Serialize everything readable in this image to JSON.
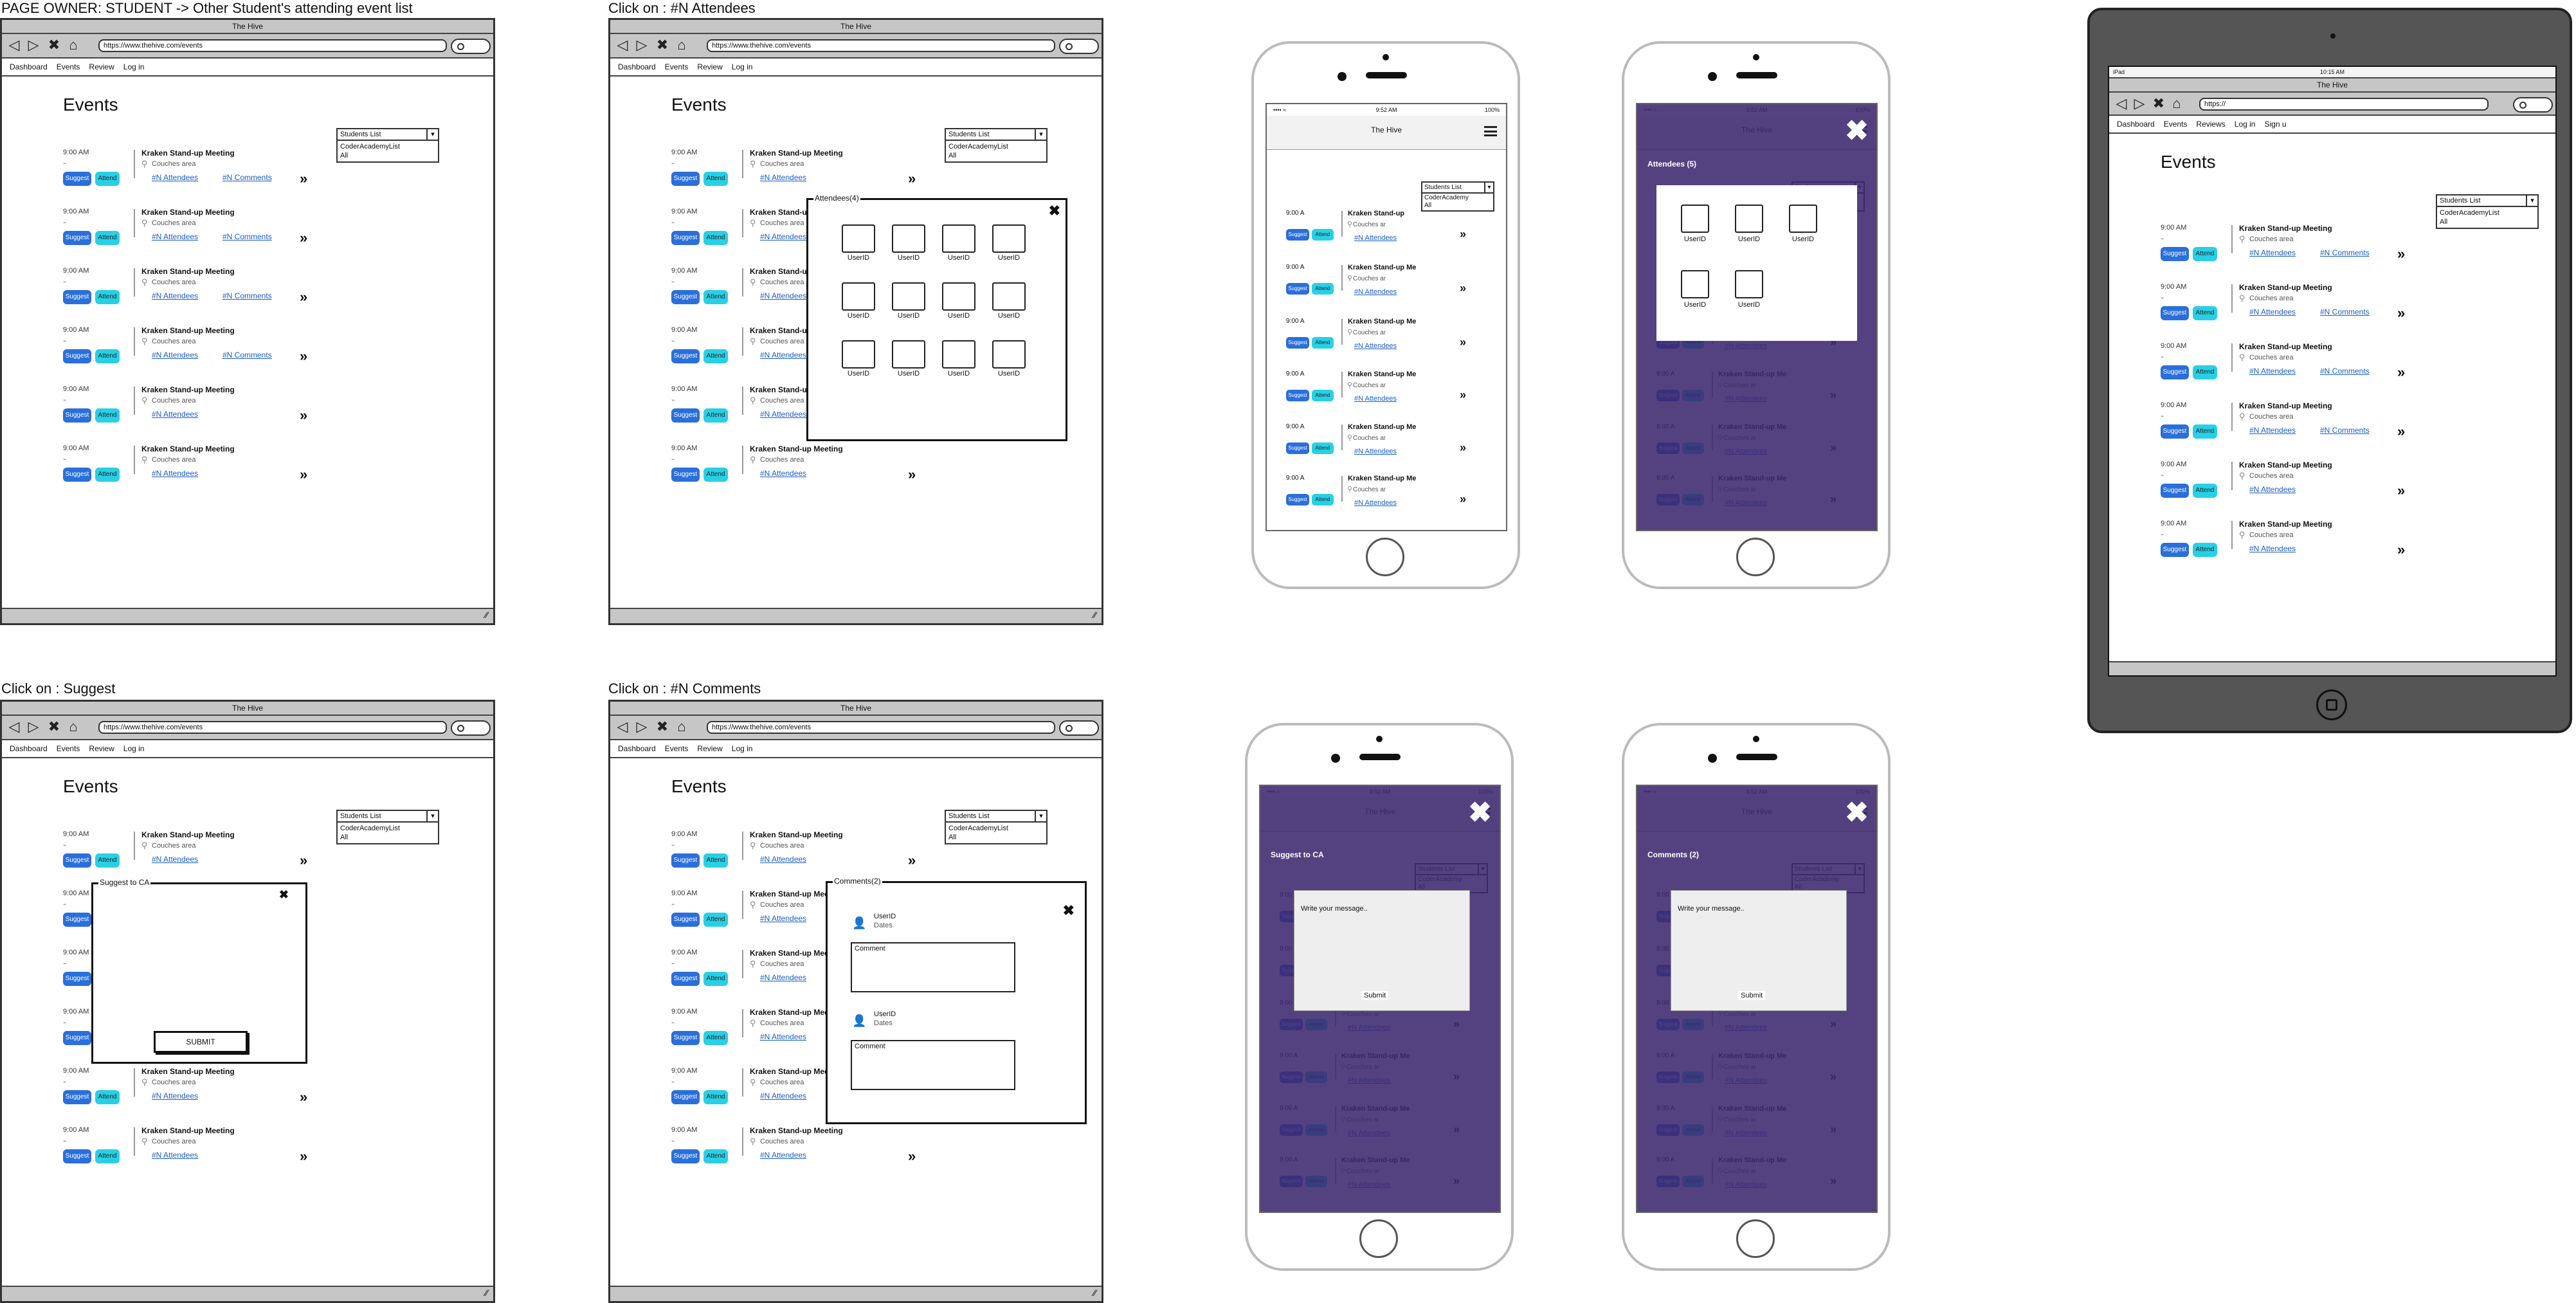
{
  "captions": {
    "c1": "PAGE OWNER: STUDENT -> Other Student's attending event list",
    "c2": "Click on : #N Attendees",
    "c3": "Click on : Suggest",
    "c4": "Click on : #N Comments"
  },
  "browser": {
    "title": "The Hive",
    "url": "https://www.thehive.com/events",
    "nav": [
      "Dashboard",
      "Events",
      "Review",
      "Log in"
    ],
    "heading": "Events"
  },
  "dropdown": {
    "label": "Students List",
    "options": [
      "CoderAcademyList",
      "All"
    ]
  },
  "event": {
    "time": "9:00 AM",
    "title": "Kraken Stand-up Meeting",
    "location": "Couches area",
    "suggest": "Suggest",
    "attend": "Attend",
    "attendees": "#N Attendees",
    "comments": "#N Comments"
  },
  "attendees_modal": {
    "title": "Attendees(4)",
    "user": "UserID"
  },
  "suggest_modal": {
    "title": "Suggest to CA",
    "submit": "SUBMIT"
  },
  "comments_modal": {
    "title": "Comments(2)",
    "user": "UserID",
    "dates": "Dates",
    "comment": "Comment"
  },
  "phone": {
    "time": "9:52 AM",
    "battery": "100%",
    "title": "The Hive",
    "event_time": "9:00 A",
    "event_title": "Kraken Stand-up",
    "event_title_b": "Kraken Stand-up Me",
    "location": "Couches ar",
    "attendees": "#N Attendees",
    "dropdown_label": "Students List",
    "dropdown_opt1": "CoderAcademy",
    "dropdown_opt2": "All",
    "attendees_overlay": "Attendees (5)",
    "suggest_overlay": "Suggest to CA",
    "comments_overlay": "Comments (2)",
    "message_placeholder": "Write your message..",
    "submit": "Submit"
  },
  "tablet": {
    "status_left": "iPad",
    "status_time": "10:15 AM",
    "title": "The Hive",
    "url": "https://",
    "nav": [
      "Dashboard",
      "Events",
      "Reviews",
      "Log in",
      "Sign u"
    ],
    "heading": "Events"
  }
}
